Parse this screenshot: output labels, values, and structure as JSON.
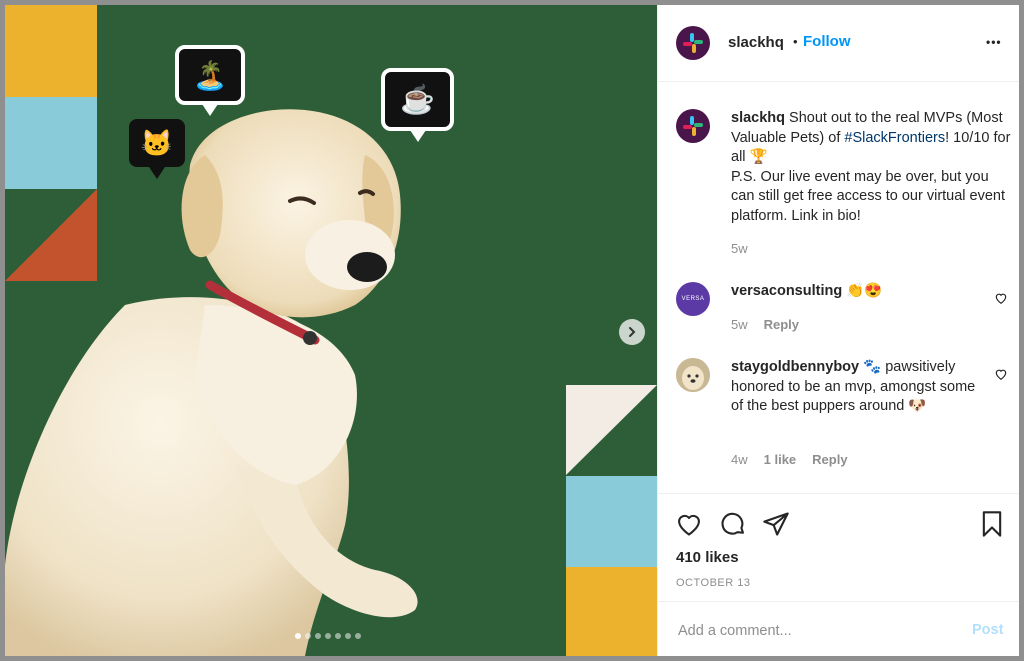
{
  "post": {
    "author": "slackhq",
    "follow_label": "Follow",
    "separator": "•",
    "more_options": "•••"
  },
  "caption": {
    "username": "slackhq",
    "text_before_tag": "Shout out to the real MVPs (Most Valuable Pets) of",
    "hashtag": "#SlackFrontiers",
    "text_after_tag": "! 10/10 for all 🏆",
    "text_second": "P.S. Our live event may be over, but you can still get free access to our virtual event platform. Link in bio!",
    "age": "5w"
  },
  "comments": [
    {
      "username": "versaconsulting",
      "text": "👏😍",
      "age": "5w",
      "likes": "",
      "reply_label": "Reply",
      "avatar_text": "VERSA"
    },
    {
      "username": "staygoldbennyboy",
      "text": "🐾 pawsitively honored to be an mvp, amongst some of the best puppers around 🐶",
      "age": "4w",
      "likes": "1 like",
      "reply_label": "Reply"
    }
  ],
  "likes_count": "410 likes",
  "date": "OCTOBER 13",
  "add_comment": {
    "placeholder": "Add a comment...",
    "post_label": "Post"
  },
  "media": {
    "bubbles": [
      "🏝️",
      "🐱",
      "☕"
    ],
    "carousel_dots": 7,
    "active_dot": 0
  },
  "colors": {
    "media_background": "#2e5e38",
    "accent": "#0095f6",
    "hashtag": "#00376b",
    "slack_purple": "#4a154b"
  }
}
